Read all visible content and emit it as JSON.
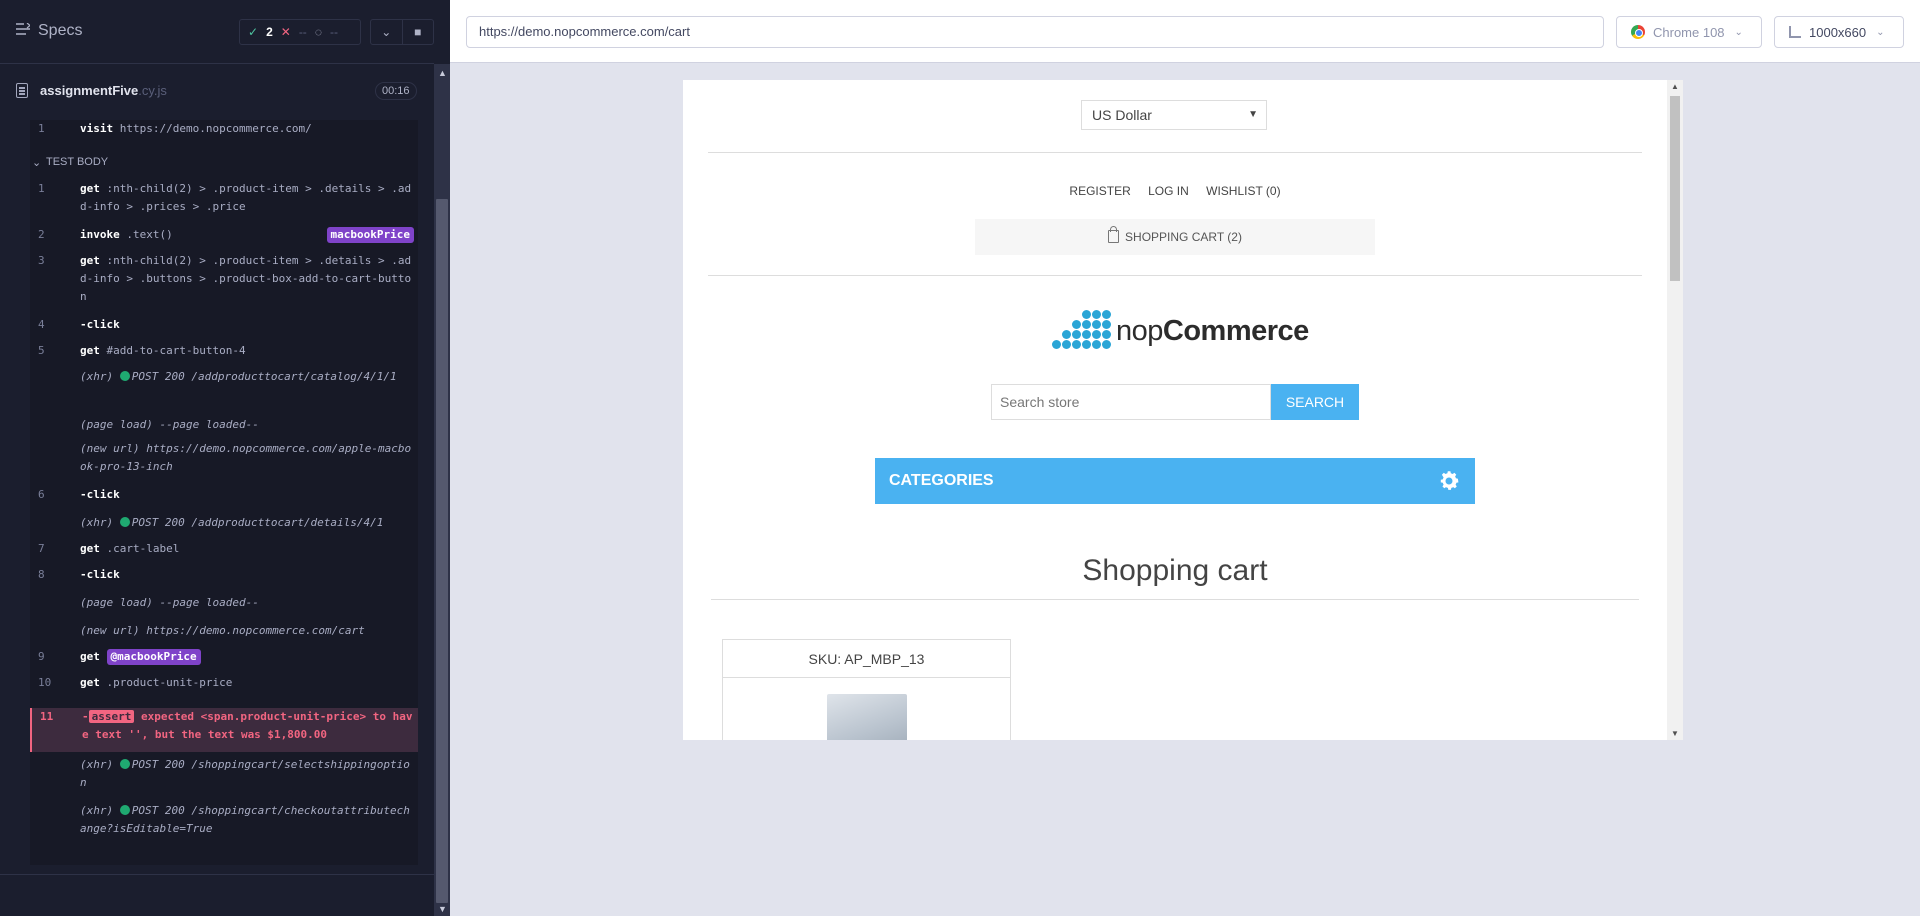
{
  "reporter": {
    "specs_label": "Specs",
    "stats": {
      "passed": "2",
      "failed": "--",
      "pending": "--"
    },
    "spec_file": {
      "name": "assignmentFive",
      "ext": ".cy.js",
      "duration": "00:16"
    },
    "before_rows": [
      {
        "num": "1",
        "cmd": "visit",
        "msg": "https://demo.nopcommerce.com/"
      }
    ],
    "test_body_label": "TEST BODY",
    "rows": [
      {
        "num": "1",
        "cmd": "get",
        "msg": ":nth-child(2) > .product-item > .details > .add-info > .prices > .price"
      },
      {
        "num": "2",
        "cmd": "invoke",
        "msg": ".text()",
        "tag": "macbookPrice"
      },
      {
        "num": "3",
        "cmd": "get",
        "msg": ":nth-child(2) > .product-item > .details > .add-info > .buttons > .product-box-add-to-cart-button"
      },
      {
        "num": "4",
        "cmd": "-click",
        "msg": ""
      },
      {
        "num": "5",
        "cmd": "get",
        "msg": "#add-to-cart-button-4"
      },
      {
        "num": "",
        "label": "(xhr)",
        "msg": "POST 200 /addproducttocart/catalog/4/1/1",
        "dot": true
      },
      {
        "num": "",
        "label": "(page load)",
        "msg": "--page loaded--"
      },
      {
        "num": "",
        "label": "(new url)",
        "msg": "https://demo.nopcommerce.com/apple-macbook-pro-13-inch"
      },
      {
        "num": "6",
        "cmd": "-click",
        "msg": ""
      },
      {
        "num": "",
        "label": "(xhr)",
        "msg": "POST 200 /addproducttocart/details/4/1",
        "dot": true
      },
      {
        "num": "7",
        "cmd": "get",
        "msg": ".cart-label"
      },
      {
        "num": "8",
        "cmd": "-click",
        "msg": ""
      },
      {
        "num": "",
        "label": "(page load)",
        "msg": "--page loaded--"
      },
      {
        "num": "",
        "label": "(new url)",
        "msg": "https://demo.nopcommerce.com/cart"
      },
      {
        "num": "9",
        "cmd": "get",
        "msg": "",
        "tag": "@macbookPrice"
      },
      {
        "num": "10",
        "cmd": "get",
        "msg": ".product-unit-price"
      },
      {
        "num": "11",
        "assert_label": "assert",
        "msg": "expected <span.product-unit-price> to have text '', but the text was $1,800.00",
        "error": true
      },
      {
        "num": "",
        "label": "(xhr)",
        "msg": "POST 200 /shoppingcart/selectshippingoption",
        "dot": true
      },
      {
        "num": "",
        "label": "(xhr)",
        "msg": "POST 200 /shoppingcart/checkoutattributechange?isEditable=True",
        "dot": true
      }
    ]
  },
  "runner": {
    "url": "https://demo.nopcommerce.com/cart",
    "browser": "Chrome 108",
    "viewport": "1000x660"
  },
  "aut": {
    "currency": "US Dollar",
    "header_links": [
      "Register",
      "Log in",
      "Wishlist (0)"
    ],
    "cart_label": "Shopping cart (2)",
    "logo_text_light": "nop",
    "logo_text_bold": "Commerce",
    "search_placeholder": "Search store",
    "search_button": "Search",
    "categories_label": "Categories",
    "page_title": "Shopping cart",
    "sku_label": "SKU: AP_MBP_13"
  },
  "colors": {
    "accent": "#4ab2f1",
    "alias_tag": "#7f43c9",
    "error": "#f26581",
    "xhr_ok": "#1fa971"
  }
}
